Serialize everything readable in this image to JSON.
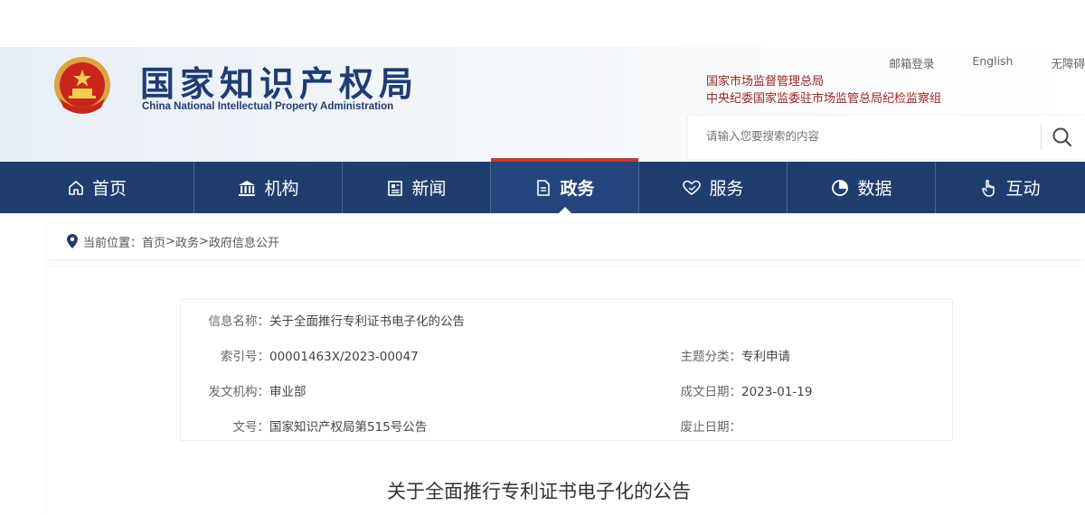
{
  "header": {
    "site_title": "国家知识产权局",
    "site_subtitle": "China National Intellectual Property Administration",
    "top_links": [
      "邮箱登录",
      "English",
      "无障碍"
    ],
    "dept_links": [
      "国家市场监督管理总局",
      "中央纪委国家监委驻市场监管总局纪检监察组"
    ],
    "search": {
      "placeholder": "请输入您要搜索的内容"
    }
  },
  "nav": {
    "items": [
      {
        "label": "首页",
        "icon": "home-icon"
      },
      {
        "label": "机构",
        "icon": "building-icon"
      },
      {
        "label": "新闻",
        "icon": "news-icon"
      },
      {
        "label": "政务",
        "icon": "document-icon",
        "active": true
      },
      {
        "label": "服务",
        "icon": "heart-hand-icon"
      },
      {
        "label": "数据",
        "icon": "pie-chart-icon"
      },
      {
        "label": "互动",
        "icon": "hand-pointer-icon"
      }
    ]
  },
  "breadcrumb": {
    "prefix": "当前位置：",
    "items": [
      "首页",
      "政务",
      "政府信息公开"
    ],
    "separator": ">"
  },
  "info": {
    "name_label": "信息名称：",
    "name_value": "关于全面推行专利证书电子化的公告",
    "index_label": "索引号：",
    "index_value": "00001463X/2023-00047",
    "topic_label": "主题分类：",
    "topic_value": "专利申请",
    "issuer_label": "发文机构：",
    "issuer_value": "审业部",
    "date_label": "成文日期：",
    "date_value": "2023-01-19",
    "docno_label": "文号：",
    "docno_value": "国家知识产权局第515号公告",
    "expire_label": "废止日期：",
    "expire_value": ""
  },
  "article": {
    "title": "关于全面推行专利证书电子化的公告"
  },
  "colors": {
    "nav_bg": "#1f3d6e",
    "brand_blue": "#1f3c73",
    "accent_red": "#c53a2c",
    "dept_red": "#9b2620"
  }
}
